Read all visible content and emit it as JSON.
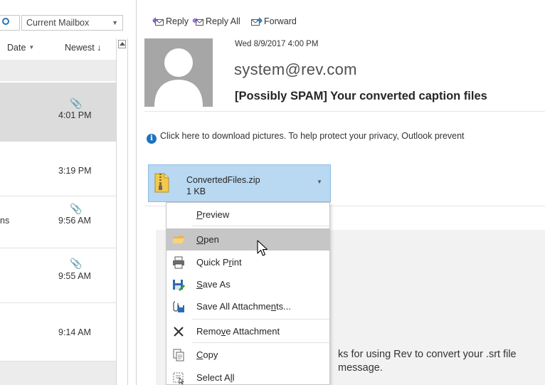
{
  "search": {
    "scope_label": "Current Mailbox"
  },
  "sort": {
    "by_label": "Date",
    "order_label": "Newest ↓"
  },
  "mail_list": [
    {
      "time": "4:01 PM",
      "has_attachment": true,
      "selected": true,
      "subject_fragment": ""
    },
    {
      "time": "3:19 PM",
      "has_attachment": false,
      "selected": false,
      "subject_fragment": ""
    },
    {
      "time": "9:56 AM",
      "has_attachment": true,
      "selected": false,
      "subject_fragment": "ns"
    },
    {
      "time": "9:55 AM",
      "has_attachment": true,
      "selected": false,
      "subject_fragment": ""
    },
    {
      "time": "9:14 AM",
      "has_attachment": false,
      "selected": false,
      "subject_fragment": ""
    }
  ],
  "toolbar": {
    "reply_label": "Reply",
    "reply_all_label": "Reply All",
    "forward_label": "Forward"
  },
  "message": {
    "datetime": "Wed 8/9/2017 4:00 PM",
    "sender": "system@rev.com",
    "subject": "[Possibly SPAM]  Your converted caption files",
    "info_bar": "Click here to download pictures. To help protect your privacy, Outlook prevent",
    "body_line1": "ks for using Rev to convert your .srt file",
    "body_line2": "message."
  },
  "attachment": {
    "name": "ConvertedFiles.zip",
    "size": "1 KB"
  },
  "context_menu": {
    "items": [
      {
        "pre": "",
        "key": "P",
        "post": "review",
        "icon": "none"
      },
      {
        "pre": "",
        "key": "O",
        "post": "pen",
        "icon": "folder-icon"
      },
      {
        "pre": "Quick P",
        "key": "r",
        "post": "int",
        "icon": "printer-icon"
      },
      {
        "pre": "",
        "key": "S",
        "post": "ave As",
        "icon": "save-as-icon"
      },
      {
        "pre": "Save All Attachme",
        "key": "n",
        "post": "ts...",
        "icon": "save-all-icon"
      },
      {
        "pre": "Remo",
        "key": "v",
        "post": "e Attachment",
        "icon": "remove-x-icon"
      },
      {
        "pre": "",
        "key": "C",
        "post": "opy",
        "icon": "copy-icon"
      },
      {
        "pre": "Select A",
        "key": "l",
        "post": "l",
        "icon": "select-all-icon"
      }
    ]
  },
  "colors": {
    "attachment_highlight": "#b9d8f1",
    "menu_hover": "#c6c6c6",
    "selected_row": "#dcdcdc",
    "info_icon": "#1e73be"
  }
}
